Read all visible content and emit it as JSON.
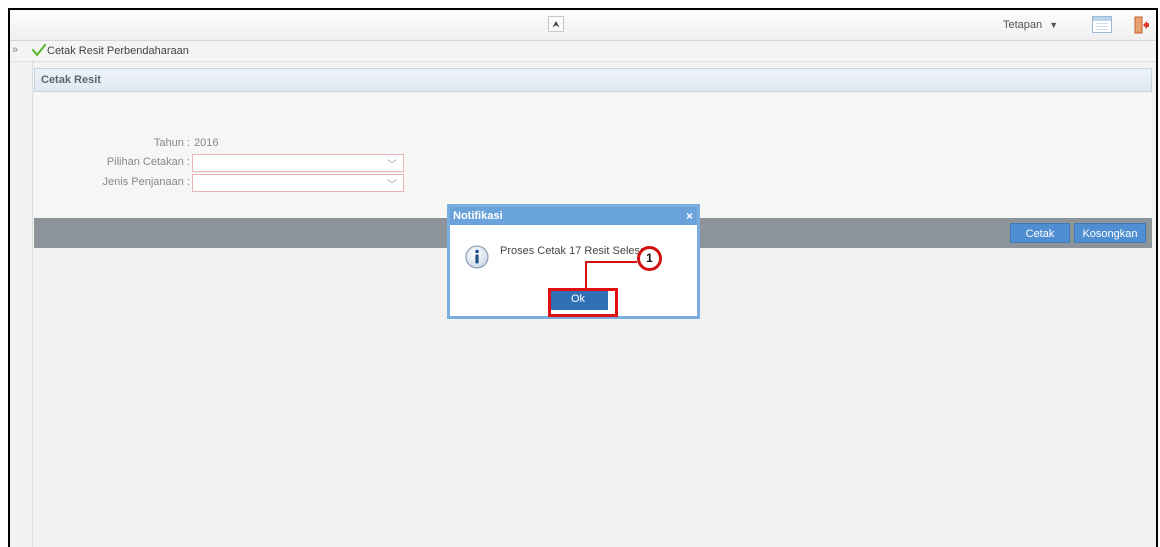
{
  "topbar": {
    "settings_label": "Tetapan",
    "settings_caret": "▼",
    "collapse_glyph": "⮝"
  },
  "breadcrumb": {
    "expand_glyph": "»",
    "title": "Cetak Resit Perbendaharaan"
  },
  "panel": {
    "title": "Cetak Resit"
  },
  "form": {
    "year": {
      "label": "Tahun :",
      "value": "2016"
    },
    "print_option": {
      "label": "Pilihan Cetakan :",
      "value": ""
    },
    "generation_type": {
      "label": "Jenis Penjanaan :",
      "value": ""
    }
  },
  "actions": {
    "print_label": "Cetak",
    "clear_label": "Kosongkan"
  },
  "dialog": {
    "title": "Notifikasi",
    "close_glyph": "×",
    "message": "Proses Cetak 17 Resit Selesai",
    "ok_label": "Ok"
  },
  "callout": {
    "number": "1"
  },
  "colors": {
    "accent_blue": "#4f8fd1",
    "dialog_header": "#6aa3dc",
    "callout_red": "#d21010"
  },
  "icons": [
    "collapse-icon",
    "calendar-icon",
    "logout-icon",
    "checkmark-icon",
    "info-icon",
    "chevron-down-icon",
    "close-icon"
  ]
}
